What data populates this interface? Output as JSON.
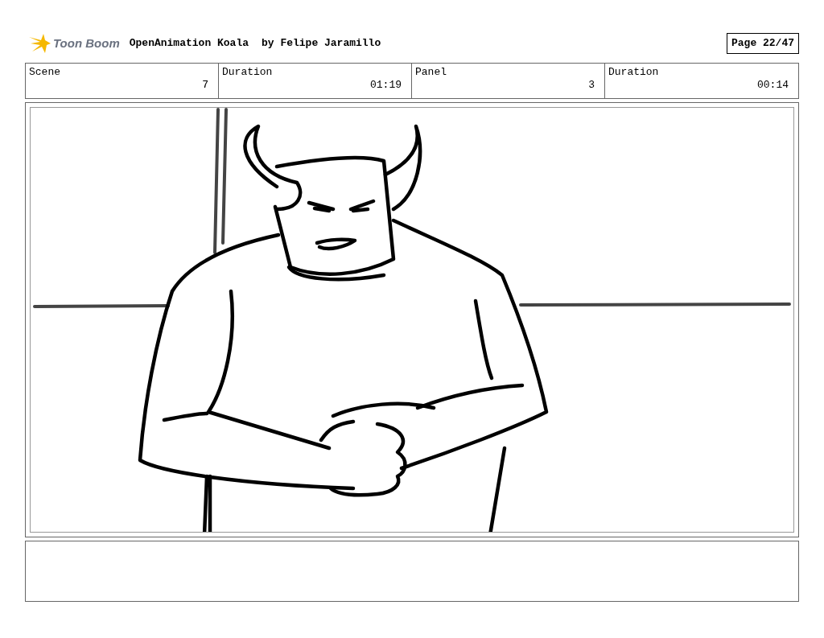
{
  "header": {
    "logo": "Toon Boom",
    "title": "OpenAnimation Koala",
    "author": "by Felipe Jaramillo",
    "page": "Page 22/47"
  },
  "info": [
    {
      "label": "Scene",
      "value": "7"
    },
    {
      "label": "Duration",
      "value": "01:19"
    },
    {
      "label": "Panel",
      "value": "3"
    },
    {
      "label": "Duration",
      "value": "00:14"
    }
  ]
}
